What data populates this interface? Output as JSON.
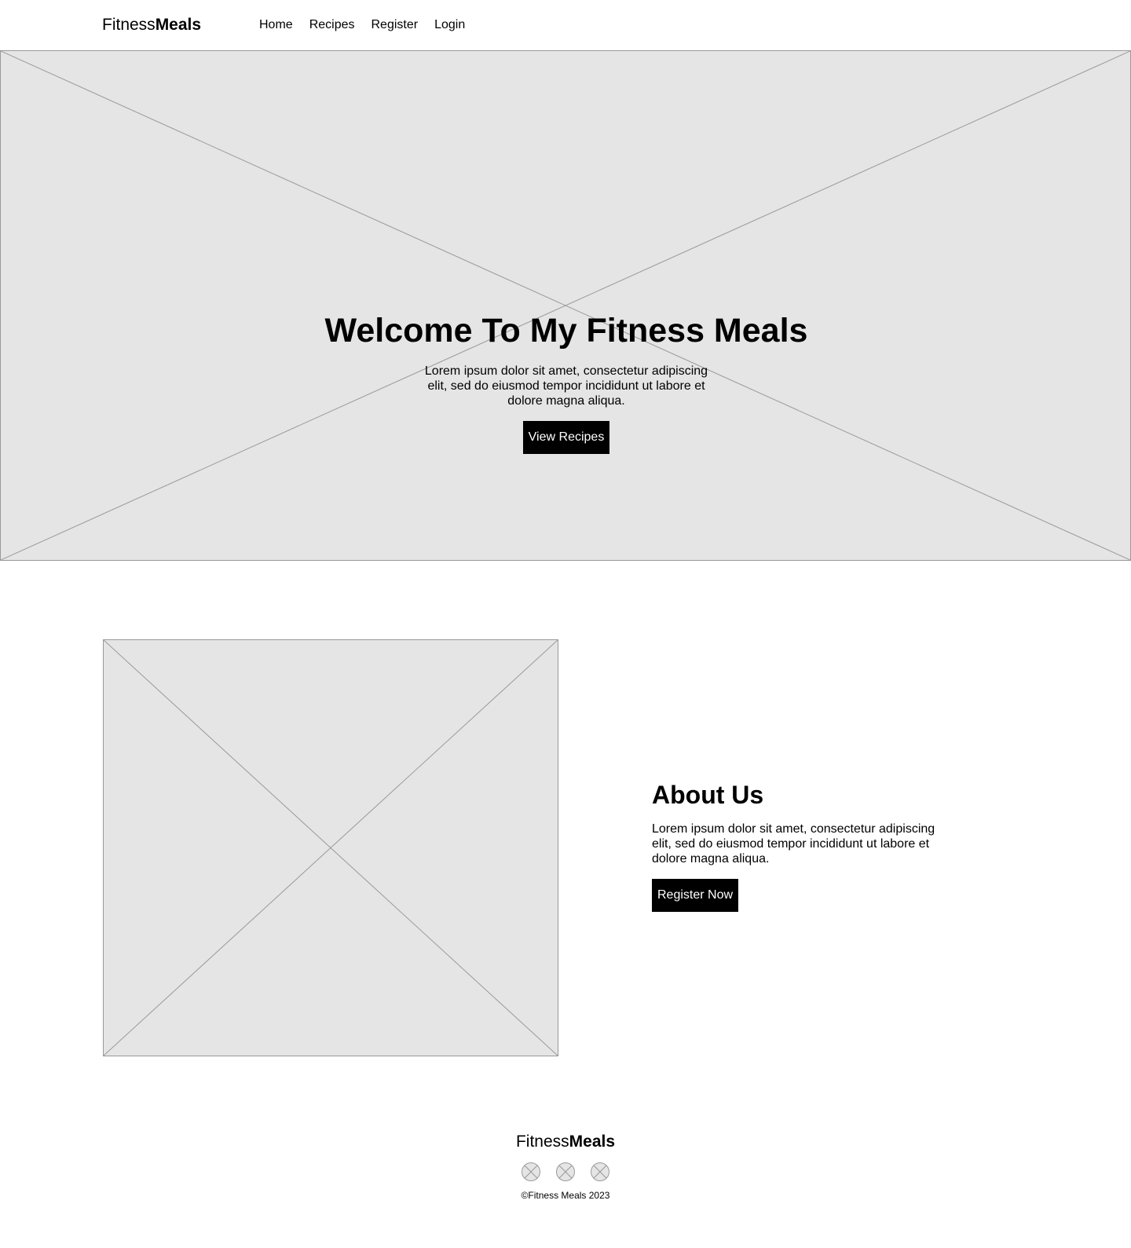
{
  "header": {
    "logo_light": "Fitness",
    "logo_bold": "Meals",
    "nav": [
      {
        "label": "Home"
      },
      {
        "label": "Recipes"
      },
      {
        "label": "Register"
      },
      {
        "label": "Login"
      }
    ]
  },
  "hero": {
    "title": "Welcome To My Fitness Meals",
    "text": "Lorem ipsum dolor sit amet, consectetur adipiscing elit, sed do eiusmod tempor incididunt ut labore et dolore magna aliqua.",
    "button_label": "View Recipes",
    "image_icon": "image-placeholder-icon"
  },
  "about": {
    "title": "About Us",
    "text": "Lorem ipsum dolor sit amet, consectetur adipiscing elit, sed do eiusmod tempor incididunt ut labore et dolore magna aliqua.",
    "button_label": "Register Now",
    "image_icon": "image-placeholder-icon"
  },
  "footer": {
    "logo_light": "Fitness",
    "logo_bold": "Meals",
    "socials": [
      {
        "icon": "social-placeholder-icon"
      },
      {
        "icon": "social-placeholder-icon"
      },
      {
        "icon": "social-placeholder-icon"
      }
    ],
    "copyright": "©Fitness Meals 2023"
  },
  "colors": {
    "placeholder_fill": "#e5e5e5",
    "placeholder_stroke": "#999999",
    "button_bg": "#000000",
    "button_text": "#ffffff"
  }
}
